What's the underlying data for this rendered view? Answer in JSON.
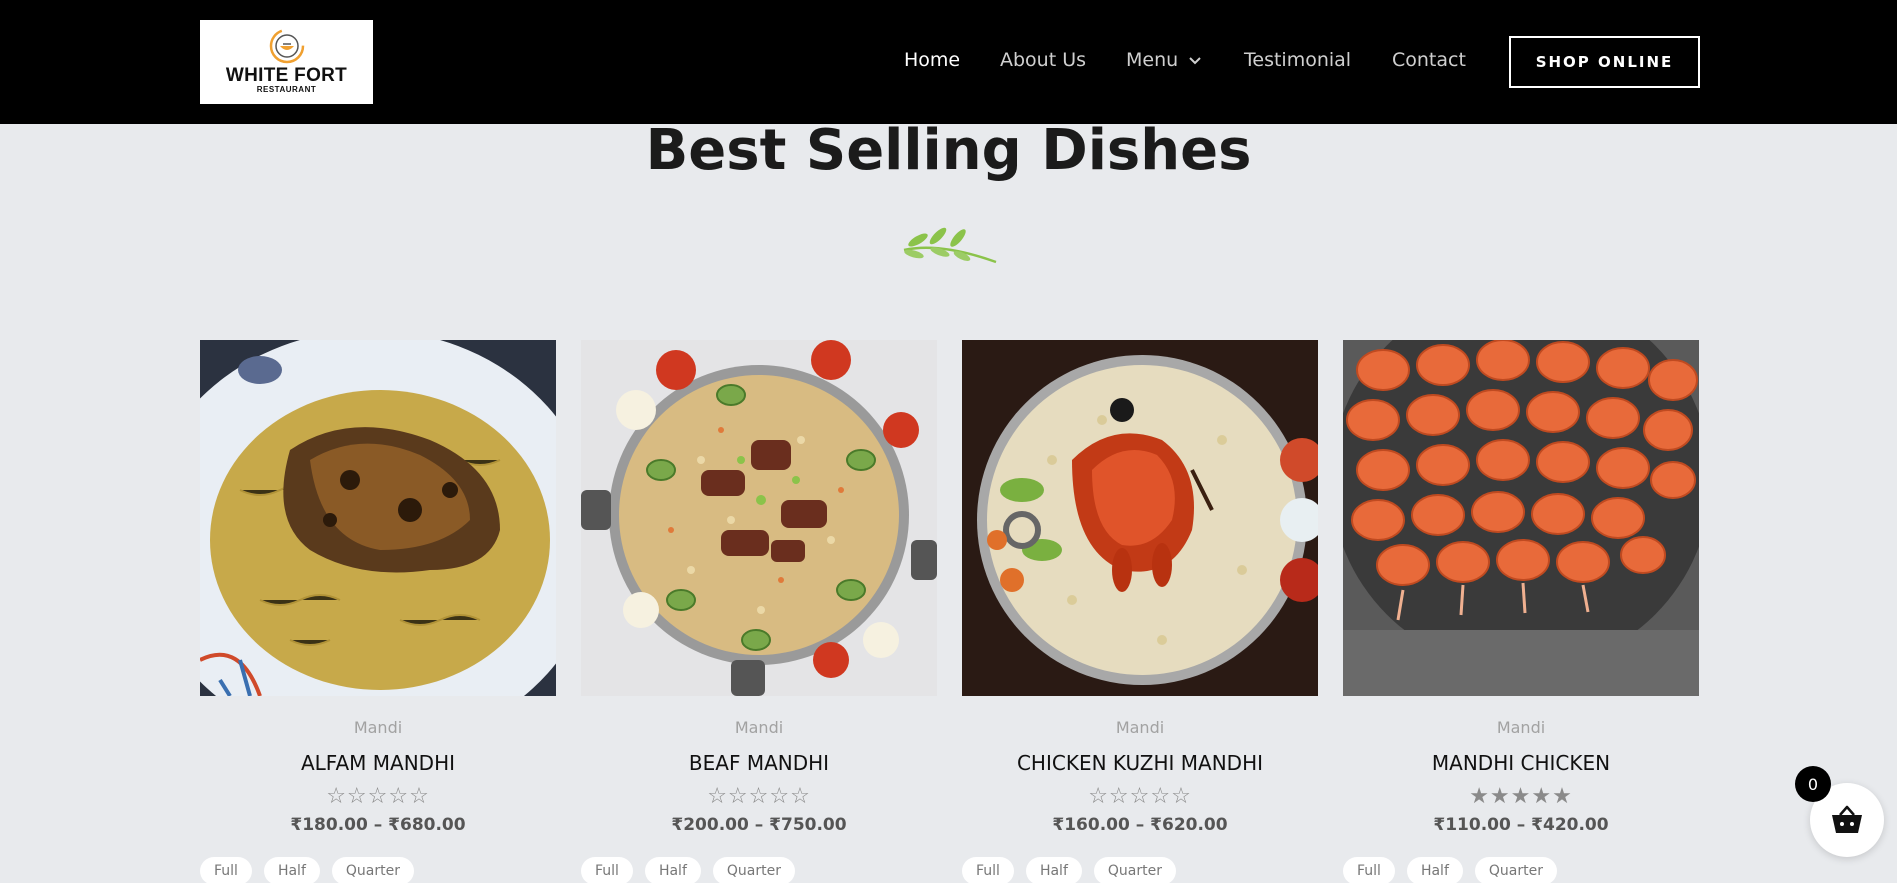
{
  "brand": {
    "name": "WHITE FORT",
    "subtitle": "RESTAURANT"
  },
  "nav": {
    "items": [
      {
        "label": "Home",
        "active": true
      },
      {
        "label": "About Us"
      },
      {
        "label": "Menu",
        "has_dropdown": true
      },
      {
        "label": "Testimonial"
      },
      {
        "label": "Contact"
      }
    ],
    "shop_button": "SHOP ONLINE"
  },
  "section": {
    "title": "Best Selling Dishes"
  },
  "products": [
    {
      "category": "Mandi",
      "name": "ALFAM MANDHI",
      "rating": 0,
      "stars": "☆☆☆☆☆",
      "price": "₹180.00 – ₹680.00",
      "options": [
        "Full",
        "Half",
        "Quarter"
      ]
    },
    {
      "category": "Mandi",
      "name": "BEAF MANDHI",
      "rating": 0,
      "stars": "☆☆☆☆☆",
      "price": "₹200.00 – ₹750.00",
      "options": [
        "Full",
        "Half",
        "Quarter"
      ]
    },
    {
      "category": "Mandi",
      "name": "CHICKEN KUZHI MANDHI",
      "rating": 0,
      "stars": "☆☆☆☆☆",
      "price": "₹160.00 – ₹620.00",
      "options": [
        "Full",
        "Half",
        "Quarter"
      ]
    },
    {
      "category": "Mandi",
      "name": "MANDHI CHICKEN",
      "rating": 5,
      "stars": "★★★★★",
      "price": "₹110.00 – ₹420.00",
      "options": [
        "Full",
        "Half",
        "Quarter"
      ]
    }
  ],
  "cart": {
    "count": "0"
  },
  "colors": {
    "header_bg": "#000000",
    "page_bg": "#e8eaed",
    "leaf": "#8bc34a"
  }
}
